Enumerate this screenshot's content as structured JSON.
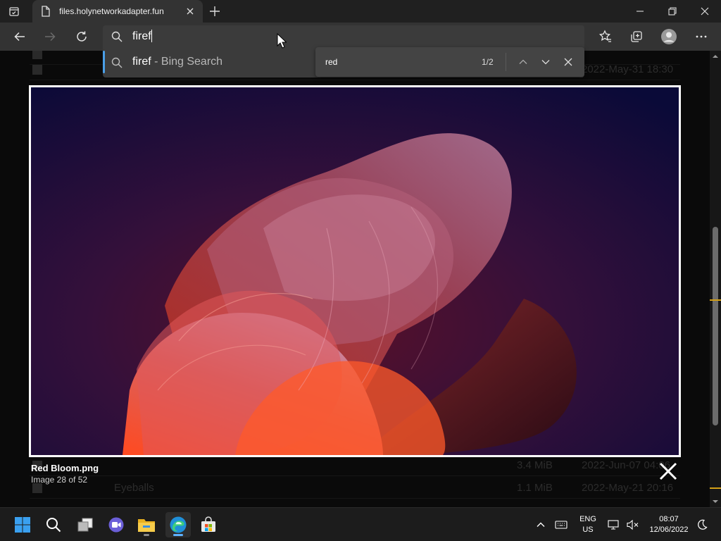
{
  "browser": {
    "tab": {
      "title": "files.holynetworkadapter.fun"
    },
    "address_bar": {
      "value": "firef"
    },
    "suggestion": {
      "query": "firef",
      "suffix": " - Bing Search"
    },
    "find": {
      "query": "red",
      "count": "1/2"
    }
  },
  "file_list": {
    "rows": [
      {
        "name": "",
        "size": "",
        "date": "2022-May-31 18:30"
      },
      {
        "name": "",
        "size": "3.4 MiB",
        "date": "2022-Jun-07 04:06"
      },
      {
        "name": "Eyeballs",
        "size": "1.1 MiB",
        "date": "2022-May-21 20:16"
      }
    ]
  },
  "lightbox": {
    "filename": "Red Bloom.png",
    "counter": "Image 28 of 52"
  },
  "taskbar": {
    "language": "ENG",
    "region": "US",
    "time": "08:07",
    "date": "12/06/2022",
    "apps": [
      "start-icon",
      "search-icon",
      "task-view-icon",
      "chat-icon",
      "file-explorer-icon",
      "edge-icon",
      "store-icon"
    ]
  },
  "colors": {
    "accent": "#4a9fe8",
    "titlebar": "#202020",
    "toolbar": "#333333",
    "taskbar": "#1c1c1c",
    "scroll_mark": "#d4a017"
  }
}
